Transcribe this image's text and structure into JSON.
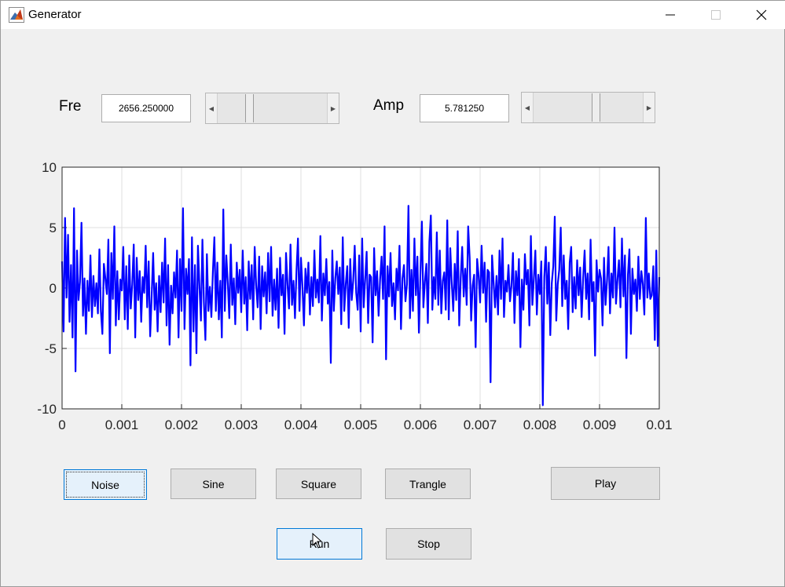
{
  "window": {
    "title": "Generator",
    "icons": {
      "app": "matlab-icon",
      "minimize": "minimize-icon",
      "maximize": "maximize-icon",
      "close": "close-icon"
    }
  },
  "controls": {
    "fre_label": "Fre",
    "fre_value": "2656.250000",
    "fre_slider_position": 0.27,
    "amp_label": "Amp",
    "amp_value": "5.781250",
    "amp_slider_position": 0.58
  },
  "buttons": {
    "noise": "Noise",
    "sine": "Sine",
    "square": "Square",
    "trangle": "Trangle",
    "play": "Play",
    "run": "Run",
    "stop": "Stop"
  },
  "colors": {
    "line": "#0000ff",
    "selected_border": "#0078d7"
  },
  "chart_data": {
    "type": "line",
    "title": "",
    "xlabel": "",
    "ylabel": "",
    "xlim": [
      0,
      0.01
    ],
    "ylim": [
      -10,
      10
    ],
    "grid": true,
    "x_ticks": [
      "0",
      "0.001",
      "0.002",
      "0.003",
      "0.004",
      "0.005",
      "0.006",
      "0.007",
      "0.008",
      "0.009",
      "0.01"
    ],
    "y_ticks": [
      "10",
      "5",
      "0",
      "-5",
      "-10"
    ],
    "x_start": 0,
    "x_step": 2e-05,
    "series": [
      {
        "color": "#0000ff",
        "values": [
          2.2,
          -3.6,
          5.8,
          -0.8,
          4.4,
          -2.8,
          1.9,
          -4.1,
          6.6,
          -6.9,
          3.1,
          -1.0,
          0.5,
          5.4,
          -2.3,
          0.8,
          -3.8,
          0.6,
          -1.9,
          2.7,
          -2.4,
          1.0,
          -1.5,
          0.4,
          -2.1,
          3.2,
          -1.9,
          -3.8,
          2.0,
          0.8,
          -0.5,
          4.0,
          -5.4,
          2.9,
          -0.9,
          5.1,
          -3.1,
          1.4,
          -2.6,
          0.7,
          -0.2,
          3.4,
          -2.6,
          1.8,
          -3.4,
          2.7,
          -1.7,
          0.3,
          3.6,
          -4.1,
          2.5,
          -1.0,
          1.4,
          -2.8,
          0.9,
          -0.4,
          3.5,
          -1.6,
          2.2,
          -4.0,
          -0.7,
          2.9,
          -1.8,
          0.4,
          -3.6,
          1.0,
          -2.0,
          2.1,
          -1.2,
          4.1,
          -3.1,
          1.9,
          -4.7,
          0.2,
          -2.1,
          1.3,
          -0.8,
          3.1,
          -4.1,
          2.4,
          -1.9,
          6.6,
          -3.4,
          1.6,
          -0.5,
          2.4,
          -6.4,
          4.2,
          -3.6,
          1.9,
          -5.4,
          3.5,
          0.2,
          -2.7,
          4.0,
          -1.2,
          -4.3,
          2.8,
          -1.9,
          0.1,
          -2.4,
          1.3,
          4.2,
          -1.9,
          2.1,
          -2.6,
          0.6,
          -4.1,
          6.5,
          -1.9,
          2.7,
          0.4,
          -2.5,
          3.6,
          -1.4,
          0.8,
          -3.0,
          2.1,
          -0.4,
          1.5,
          -2.0,
          3.1,
          -1.3,
          0.9,
          -3.5,
          2.2,
          -0.9,
          1.9,
          -2.6,
          3.4,
          0.2,
          -1.6,
          2.6,
          -3.4,
          1.8,
          -0.7,
          1.3,
          -2.1,
          2.9,
          -1.1,
          3.4,
          -2.3,
          0.7,
          -1.8,
          1.6,
          -3.3,
          2.5,
          -0.6,
          1.1,
          -3.8,
          2.9,
          0.3,
          -1.7,
          3.6,
          -1.4,
          0.6,
          -2.5,
          1.4,
          4.1,
          -1.9,
          2.5,
          0.1,
          -3.1,
          1.6,
          -0.4,
          2.1,
          -2.2,
          0.9,
          -1.5,
          3.1,
          -0.8,
          0.7,
          -1.2,
          4.3,
          -2.7,
          1.2,
          -0.6,
          2.4,
          -1.3,
          0.5,
          -6.2,
          3.1,
          -1.9,
          0.8,
          2.2,
          -0.5,
          1.7,
          -3.0,
          4.2,
          -1.9,
          0.3,
          1.8,
          -3.3,
          2.4,
          -1.0,
          0.6,
          3.5,
          -0.4,
          -1.8,
          2.7,
          -3.6,
          4.1,
          -1.6,
          0.7,
          3.0,
          -2.9,
          1.1,
          0.9,
          -4.5,
          3.3,
          -0.6,
          1.4,
          -2.3,
          0.7,
          2.6,
          -0.9,
          5.1,
          -5.9,
          1.8,
          -0.7,
          2.9,
          -1.5,
          0.4,
          -2.6,
          1.6,
          -0.2,
          3.5,
          -3.4,
          0.8,
          1.9,
          -1.1,
          0.3,
          6.8,
          -2.5,
          1.5,
          -1.9,
          4.1,
          -0.6,
          2.6,
          -3.7,
          1.1,
          5.5,
          -1.6,
          0.5,
          2.0,
          -2.9,
          3.8,
          6.0,
          -1.8,
          0.9,
          -0.9,
          4.6,
          -1.4,
          3.1,
          -2.1,
          0.6,
          1.3,
          -1.8,
          5.6,
          -2.6,
          3.3,
          0.4,
          -1.9,
          2.0,
          -1.0,
          4.7,
          -3.1,
          0.8,
          3.4,
          -0.7,
          1.6,
          -1.4,
          5.1,
          2.5,
          -2.7,
          0.2,
          1.1,
          -4.9,
          2.4,
          1.0,
          -1.2,
          3.5,
          -0.4,
          2.1,
          -2.8,
          1.5,
          1.3,
          -7.8,
          2.7,
          0.5,
          -1.6,
          1.0,
          -2.2,
          3.1,
          -0.9,
          4.1,
          -2.4,
          0.6,
          -0.3,
          1.9,
          -1.1,
          0.2,
          2.9,
          -2.9,
          1.4,
          -0.6,
          2.4,
          -4.9,
          0.7,
          -1.8,
          2.8,
          0.3,
          1.5,
          -3.1,
          4.3,
          -1.4,
          0.8,
          3.1,
          -2.2,
          1.1,
          -0.5,
          2.2,
          -9.7,
          0.9,
          3.4,
          -1.3,
          2.1,
          -3.9,
          0.4,
          1.8,
          5.9,
          -2.7,
          0.3,
          1.5,
          5.0,
          -1.5,
          2.7,
          -0.9,
          0.6,
          -3.4,
          2.1,
          3.4,
          -2.0,
          0.9,
          -1.7,
          2.3,
          -0.6,
          1.7,
          -2.4,
          0.8,
          3.1,
          -0.9,
          1.2,
          -2.6,
          4.0,
          -1.1,
          0.5,
          -5.6,
          2.3,
          -0.3,
          1.5,
          0.8,
          -3.1,
          2.5,
          -1.4,
          0.6,
          3.4,
          -2.1,
          1.2,
          -0.8,
          5.0,
          -1.3,
          0.7,
          2.3,
          -1.6,
          4.1,
          -0.7,
          2.7,
          -5.8,
          1.1,
          3.2,
          -3.8,
          1.6,
          -0.5,
          0.7,
          -1.9,
          2.6,
          -0.9,
          1.4,
          0.3,
          -2.2,
          5.8,
          -0.8,
          1.2,
          -0.9,
          -0.6,
          1.8,
          -4.3,
          3.1,
          -4.8,
          0.9
        ]
      }
    ]
  }
}
